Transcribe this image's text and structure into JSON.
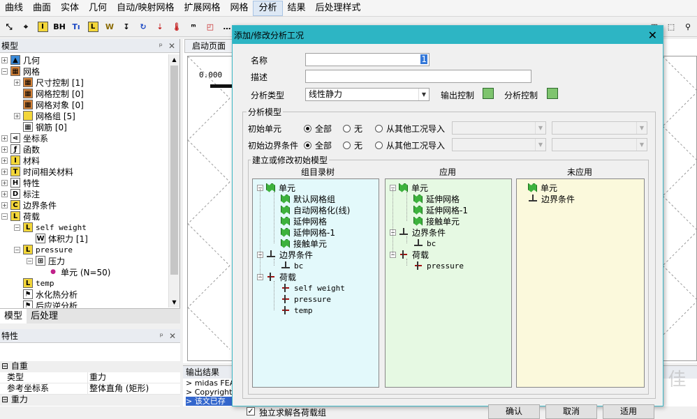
{
  "menu": [
    "曲线",
    "曲面",
    "实体",
    "几何",
    "自动/映射网格",
    "扩展网格",
    "网格",
    "分析",
    "结果",
    "后处理样式"
  ],
  "menu_active_index": 7,
  "model_panel": {
    "title": "模型",
    "tree": [
      {
        "label": "几何",
        "icon": "geometry-icon"
      },
      {
        "label": "网格",
        "icon": "mesh-icon"
      },
      {
        "label": "尺寸控制 [1]",
        "icon": "size-control-icon"
      },
      {
        "label": "网格控制 [0]",
        "icon": "mesh-control-icon"
      },
      {
        "label": "网格对象 [0]",
        "icon": "mesh-object-icon"
      },
      {
        "label": "网格组 [5]",
        "icon": "folder-icon"
      },
      {
        "label": "钢筋 [0]",
        "icon": "rebar-icon"
      },
      {
        "label": "坐标系",
        "icon": "coordinate-icon"
      },
      {
        "label": "函数",
        "icon": "function-icon"
      },
      {
        "label": "材料",
        "icon": "material-icon"
      },
      {
        "label": "时间相关材料",
        "icon": "time-material-icon"
      },
      {
        "label": "特性",
        "icon": "property-icon"
      },
      {
        "label": "标注",
        "icon": "dimension-icon"
      },
      {
        "label": "边界条件",
        "icon": "boundary-icon"
      },
      {
        "label": "荷载",
        "icon": "load-icon"
      },
      {
        "label": "self weight",
        "icon": "load-set-icon"
      },
      {
        "label": "体积力 [1]",
        "icon": "body-force-icon"
      },
      {
        "label": "pressure",
        "icon": "load-set-icon"
      },
      {
        "label": "压力",
        "icon": "pressure-icon"
      },
      {
        "label": "单元 (N=50)",
        "icon": "element-dot-icon"
      },
      {
        "label": "temp",
        "icon": "load-set-icon"
      },
      {
        "label": "水化热分析",
        "icon": "heat-icon"
      },
      {
        "label": "后应逆分析",
        "icon": "analysis-icon"
      }
    ]
  },
  "bottom_tabs": [
    "模型",
    "后处理"
  ],
  "props_panel": {
    "title": "特性",
    "group1": "自重",
    "rows": [
      {
        "k": "类型",
        "v": "重力"
      },
      {
        "k": "参考坐标系",
        "v": "整体直角 (矩形)"
      }
    ],
    "group2": "重力"
  },
  "doc_tab": "启动页面",
  "viewport_label": "0.000",
  "output": {
    "title": "输出结果",
    "lines": [
      "> midas FEA",
      "> Copyright",
      "> 该文已存"
    ]
  },
  "dialog": {
    "title": "添加/修改分析工况",
    "name_label": "名称",
    "name_value": "1",
    "desc_label": "描述",
    "desc_value": "",
    "type_label": "分析类型",
    "type_value": "线性静力",
    "output_control": "输出控制",
    "analysis_control": "分析控制",
    "model_group": "分析模型",
    "init_element": "初始单元",
    "init_boundary": "初始边界条件",
    "opt_all": "全部",
    "opt_none": "无",
    "opt_import": "从其他工况导入",
    "build_group": "建立或修改初始模型",
    "col_tree": "组目录树",
    "col_apply": "应用",
    "col_unapplied": "未应用",
    "tree_col": {
      "elements": "单元",
      "element_items": [
        "默认网格组",
        "自动网格化(线)",
        "延伸网格",
        "延伸网格-1",
        "接触单元"
      ],
      "boundary": "边界条件",
      "boundary_items": [
        "bc"
      ],
      "loads": "荷载",
      "load_items": [
        "self weight",
        "pressure",
        "temp"
      ]
    },
    "apply_col": {
      "elements": "单元",
      "element_items": [
        "延伸网格",
        "延伸网格-1",
        "接触单元"
      ],
      "boundary": "边界条件",
      "boundary_items": [
        "bc"
      ],
      "loads": "荷载",
      "load_items": [
        "pressure"
      ]
    },
    "unapplied_col": {
      "elements": "单元",
      "boundary": "边界条件"
    },
    "solve_label": "独立求解各荷载组",
    "solve_checked": true,
    "ok": "确认",
    "cancel": "取消",
    "apply": "适用",
    "colors": {
      "title_bar": "#2db5c4",
      "tree_bg": "#e3f9fb",
      "apply_bg": "#e6f9e3",
      "unapplied_bg": "#fbf9dc"
    }
  },
  "watermark": "榛 秭 佳"
}
